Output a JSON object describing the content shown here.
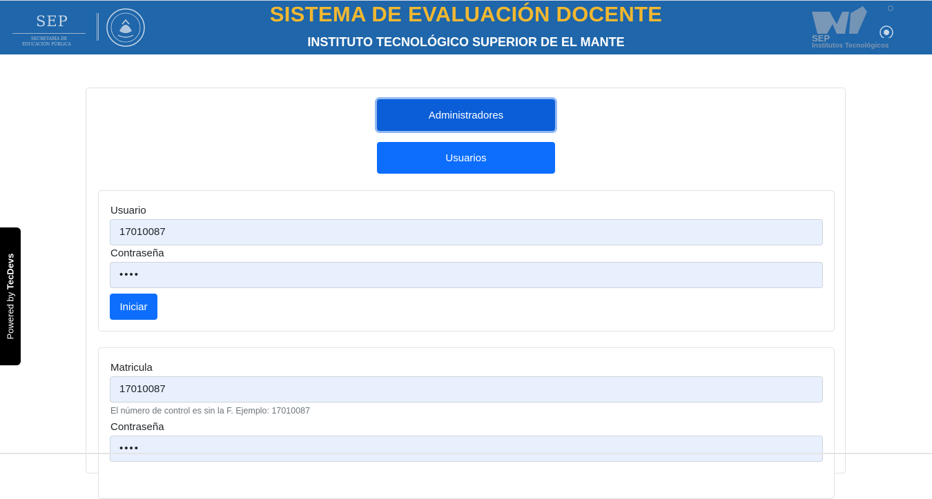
{
  "header": {
    "sep_logo_text": "SEP",
    "sep_sub_line1": "SECRETARÍA DE",
    "sep_sub_line2": "EDUCACIÓN PÚBLICA",
    "title": "SISTEMA DE EVALUACIÓN DOCENTE",
    "subtitle": "INSTITUTO TECNOLÓGICO SUPERIOR DE EL MANTE",
    "tec_logo_sep": "SEP",
    "tec_logo_name": "Institutos Tecnológicos",
    "colors": {
      "bar": "#1f66aa",
      "title": "#f2b830",
      "subtitle": "#ffffff"
    }
  },
  "side_badge": {
    "prefix": "Powered by ",
    "brand": "TecDevs"
  },
  "roles": {
    "admin_label": "Administradores",
    "user_label": "Usuarios"
  },
  "admin_form": {
    "user_label": "Usuario",
    "user_value": "17010087",
    "password_label": "Contraseña",
    "password_value": "••••",
    "submit_label": "Iniciar"
  },
  "student_form": {
    "id_label": "Matricula",
    "id_value": "17010087",
    "id_hint": "El número de control es sin la F. Ejemplo: 17010087",
    "password_label": "Contraseña",
    "password_value": "••••"
  }
}
